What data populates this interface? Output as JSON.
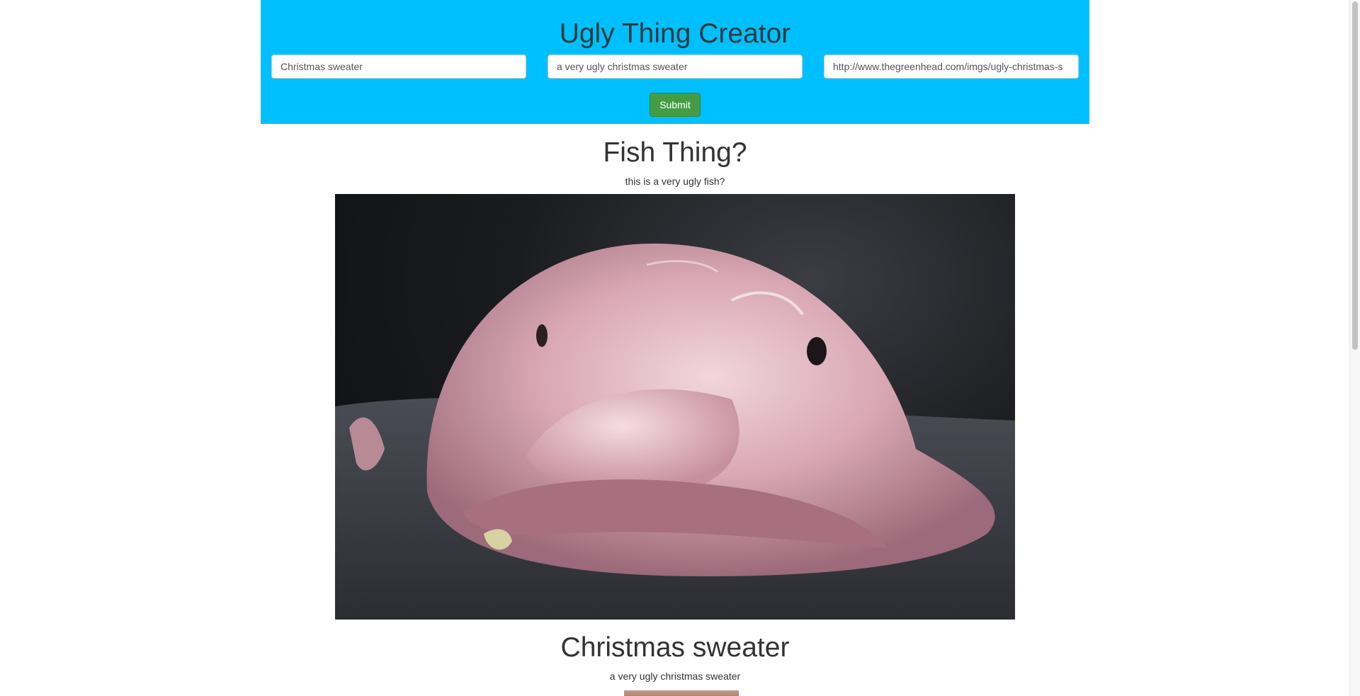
{
  "header": {
    "title": "Ugly Thing Creator",
    "name_value": "Christmas sweater",
    "description_value": "a very ugly christmas sweater",
    "url_value": "http://www.thegreenhead.com/imgs/ugly-christmas-s",
    "submit_label": "Submit",
    "background_color": "#00bfff",
    "submit_color": "#449d44"
  },
  "things": [
    {
      "title": "Fish Thing?",
      "description": "this is a very ugly fish?",
      "image": "blobfish-photo"
    },
    {
      "title": "Christmas sweater",
      "description": "a very ugly christmas sweater",
      "image": "ugly-christmas-sweater-photo"
    }
  ]
}
